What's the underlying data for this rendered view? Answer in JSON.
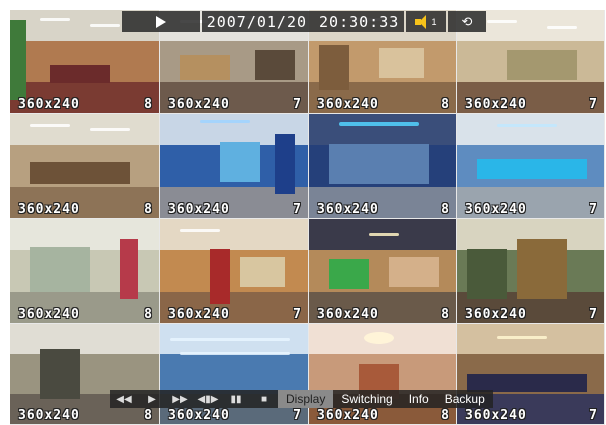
{
  "status_bar": {
    "play_icon": "play-icon",
    "date": "2007/01/20",
    "time": "20:30:33",
    "audio_channel": "1",
    "audio_icon": "speaker-icon",
    "network_icon": "network-icon"
  },
  "tiles": [
    {
      "resolution": "360x240",
      "frame_rate": "8"
    },
    {
      "resolution": "360x240",
      "frame_rate": "7"
    },
    {
      "resolution": "360x240",
      "frame_rate": "8"
    },
    {
      "resolution": "360x240",
      "frame_rate": "7"
    },
    {
      "resolution": "360x240",
      "frame_rate": "8"
    },
    {
      "resolution": "360x240",
      "frame_rate": "7"
    },
    {
      "resolution": "360x240",
      "frame_rate": "8"
    },
    {
      "resolution": "360x240",
      "frame_rate": "7"
    },
    {
      "resolution": "360x240",
      "frame_rate": "8"
    },
    {
      "resolution": "360x240",
      "frame_rate": "7"
    },
    {
      "resolution": "360x240",
      "frame_rate": "8"
    },
    {
      "resolution": "360x240",
      "frame_rate": "7"
    },
    {
      "resolution": "360x240",
      "frame_rate": "8"
    },
    {
      "resolution": "360x240",
      "frame_rate": "7"
    },
    {
      "resolution": "360x240",
      "frame_rate": "8"
    },
    {
      "resolution": "360x240",
      "frame_rate": "7"
    }
  ],
  "controls": {
    "rewind": "◀◀",
    "play": "▶",
    "fast_forward": "▶▶",
    "step": "◀▮▶",
    "pause": "▮▮",
    "stop": "■"
  },
  "menu": {
    "display": "Display",
    "switching": "Switching",
    "info": "Info",
    "backup": "Backup"
  }
}
